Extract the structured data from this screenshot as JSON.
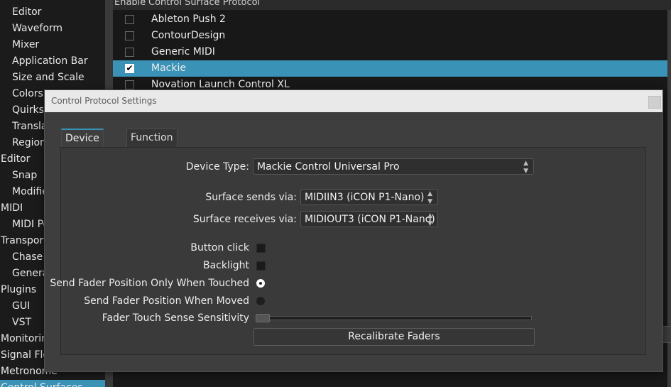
{
  "sidebar": {
    "items": [
      {
        "label": "Editor",
        "level": "child"
      },
      {
        "label": "Waveform",
        "level": "child"
      },
      {
        "label": "Mixer",
        "level": "child"
      },
      {
        "label": "Application Bar",
        "level": "child"
      },
      {
        "label": "Size and Scale",
        "level": "child"
      },
      {
        "label": "Colors",
        "level": "child"
      },
      {
        "label": "Quirks",
        "level": "child"
      },
      {
        "label": "Translat",
        "level": "child"
      },
      {
        "label": "Regions",
        "level": "child"
      },
      {
        "label": "Editor",
        "level": "parent"
      },
      {
        "label": "Snap",
        "level": "child"
      },
      {
        "label": "Modifier",
        "level": "child"
      },
      {
        "label": "MIDI",
        "level": "parent"
      },
      {
        "label": "MIDI Po",
        "level": "child"
      },
      {
        "label": "Transport",
        "level": "parent"
      },
      {
        "label": "Chase",
        "level": "child"
      },
      {
        "label": "Generat",
        "level": "child"
      },
      {
        "label": "Plugins",
        "level": "parent"
      },
      {
        "label": "GUI",
        "level": "child"
      },
      {
        "label": "VST",
        "level": "child"
      },
      {
        "label": "Monitoring",
        "level": "parent"
      },
      {
        "label": "Signal Flow",
        "level": "parent"
      },
      {
        "label": "Metronome",
        "level": "parent"
      },
      {
        "label": "Control Surfaces",
        "level": "parent",
        "selected": true
      }
    ]
  },
  "table": {
    "header_enable": "Enable",
    "header_protocol": "Control Surface Protocol",
    "rows": [
      {
        "name": "Ableton Push 2",
        "enabled": false
      },
      {
        "name": "ContourDesign",
        "enabled": false
      },
      {
        "name": "Generic MIDI",
        "enabled": false
      },
      {
        "name": "Mackie",
        "enabled": true,
        "selected": true
      },
      {
        "name": "Novation Launch Control XL",
        "enabled": false
      }
    ],
    "check_glyph": "✔"
  },
  "dialog": {
    "title": "Control Protocol Settings",
    "tabs": [
      {
        "label": "Device Setup",
        "active": true
      },
      {
        "label": "Function Keys",
        "active": false
      }
    ],
    "device_type_label": "Device Type:",
    "device_type_value": "Mackie Control Universal Pro",
    "sends_label": "Surface sends via:",
    "sends_value": "MIDIIN3 (iCON P1-Nano)",
    "receives_label": "Surface receives via:",
    "receives_value": "MIDIOUT3 (iCON P1-Nano)",
    "button_click_label": "Button click",
    "button_click_checked": false,
    "backlight_label": "Backlight",
    "backlight_checked": false,
    "fader_touched_label": "Send Fader Position Only When Touched",
    "fader_touched_selected": true,
    "fader_moved_label": "Send Fader Position When Moved",
    "fader_moved_selected": false,
    "sensitivity_label": "Fader Touch Sense Sensitivity",
    "sensitivity_level": 0.0,
    "recalibrate_label": "Recalibrate Faders",
    "spinner_glyph": "⌃⌄"
  },
  "colors": {
    "accent": "#3a93b6",
    "sidebar_bg": "#1b1b1b",
    "dialog_bg": "#3e3e3e",
    "title_bar_bg": "#e9e9e9"
  },
  "icons": {
    "checkbox": "checkbox-icon",
    "combo_arrows": "updown-chevron-icon",
    "close": "close-icon"
  }
}
